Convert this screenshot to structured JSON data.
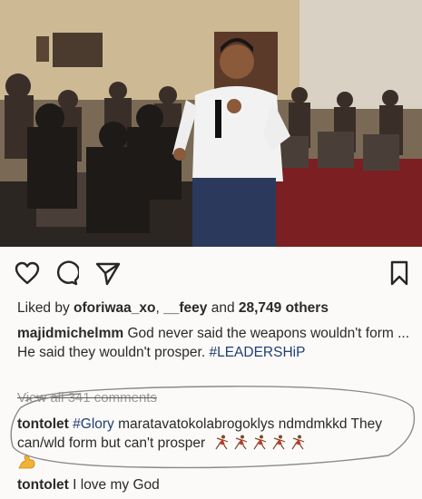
{
  "post": {
    "image_alt_subject": "man-speaking-into-microphone",
    "actions": {
      "like_icon": "heart-outline-icon",
      "comment_icon": "comment-bubble-icon",
      "share_icon": "paper-plane-icon",
      "save_icon": "bookmark-icon"
    },
    "likes": {
      "prefix": "Liked by ",
      "user1": "oforiwaa_xo",
      "separator": ", ",
      "user2": "__feey",
      "suffix": " and ",
      "count": "28,749 others"
    },
    "caption": {
      "username": "majidmichelmm",
      "text": " God never said the weapons wouldn't form ... He said they wouldn't prosper. ",
      "hashtag": "#LEADERSHiP"
    },
    "view_all_comments": "View all 341 comments",
    "comments": [
      {
        "username": "tontolet",
        "hashtag": "#Glory",
        "text": " maratavatokolabrogoklys ndmdmkkd They can/wld form but can't prosper"
      },
      {
        "username": "tontolet",
        "text": " I love my God"
      }
    ],
    "colors": {
      "background": "#fbfaf8",
      "hashtag": "#1f3f73",
      "annotation_circle": "#8a8a8a",
      "dancer_emoji": "#c0392b"
    }
  }
}
